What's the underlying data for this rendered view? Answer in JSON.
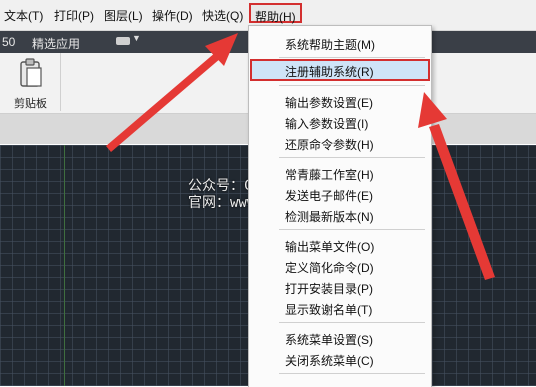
{
  "menubar": {
    "items": [
      "文本(T)",
      "打印(P)",
      "图层(L)",
      "操作(D)",
      "快选(Q)"
    ],
    "active_item": "帮助(H)"
  },
  "tabrow": {
    "zoom_fragment": "50",
    "tab_label": "精选应用"
  },
  "ribbon": {
    "paste_label": "剪贴板"
  },
  "watermark": {
    "line1": "公众号：CAD管家",
    "line2": "官网：www.cadgj.cn"
  },
  "dropdown": {
    "items": [
      "系统帮助主题(M)",
      "注册辅助系统(R)",
      "输出参数设置(E)",
      "输入参数设置(I)",
      "还原命令参数(H)",
      "常青藤工作室(H)",
      "发送电子邮件(E)",
      "检测最新版本(N)",
      "输出菜单文件(O)",
      "定义简化命令(D)",
      "打开安装目录(P)",
      "显示致谢名单(T)",
      "系统菜单设置(S)",
      "关闭系统菜单(C)"
    ],
    "highlighted_index": 1
  },
  "colors": {
    "highlight_border": "#d32f2f",
    "highlight_fill": "#cfe4f7",
    "canvas": "#212830",
    "annotation_arrow": "#e53935"
  }
}
